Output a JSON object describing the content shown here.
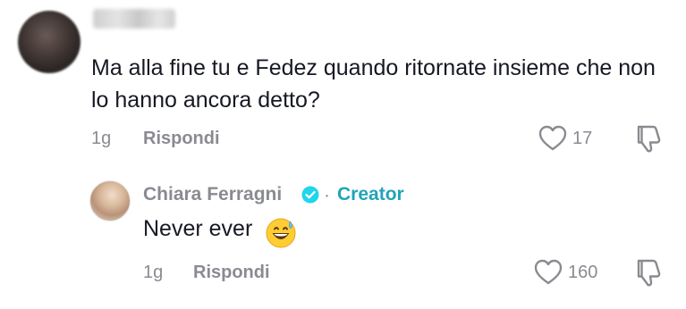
{
  "comment": {
    "text": "Ma alla fine tu e Fedez quando ritornate insieme che non lo hanno ancora detto?",
    "time": "1g",
    "reply_label": "Rispondi",
    "like_count": "17"
  },
  "reply": {
    "author": "Chiara Ferragni",
    "separator": "·",
    "badge_label": "Creator",
    "text": "Never ever",
    "time": "1g",
    "reply_label": "Rispondi",
    "like_count": "160"
  },
  "icons": {
    "like": "heart-outline-icon",
    "dislike": "thumbs-down-icon",
    "verified": "verified-check-icon",
    "emoji": "grinning-sweat-emoji"
  },
  "colors": {
    "text": "#161823",
    "muted": "#8a8b91",
    "creator_accent": "#20a4b8",
    "verified_badge": "#20d5ec"
  }
}
